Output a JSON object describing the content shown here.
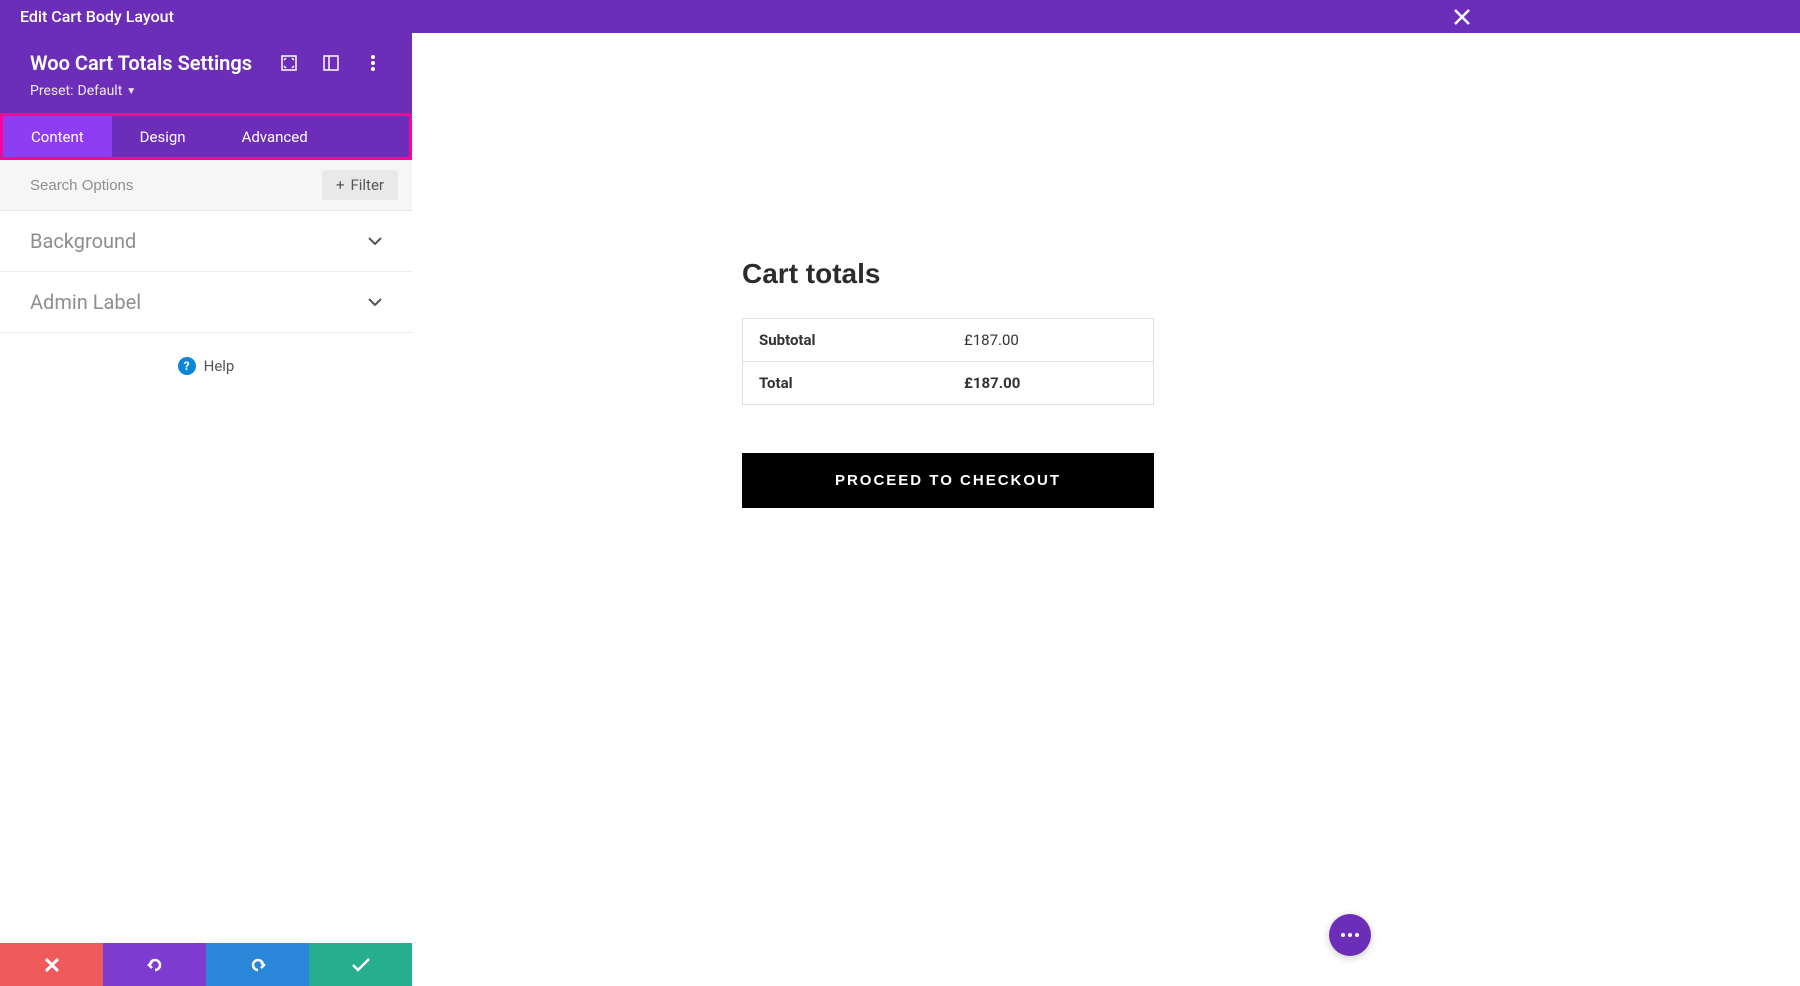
{
  "topBar": {
    "title": "Edit Cart Body Layout"
  },
  "settings": {
    "title": "Woo Cart Totals Settings",
    "presetLabel": "Preset:",
    "presetValue": "Default"
  },
  "tabs": {
    "content": "Content",
    "design": "Design",
    "advanced": "Advanced"
  },
  "search": {
    "placeholder": "Search Options",
    "filterLabel": "Filter"
  },
  "accordion": {
    "background": "Background",
    "adminLabel": "Admin Label"
  },
  "help": {
    "label": "Help"
  },
  "preview": {
    "cartTotalsTitle": "Cart totals",
    "subtotalLabel": "Subtotal",
    "subtotalValue": "£187.00",
    "totalLabel": "Total",
    "totalValue": "£187.00",
    "checkoutLabel": "PROCEED TO CHECKOUT"
  }
}
